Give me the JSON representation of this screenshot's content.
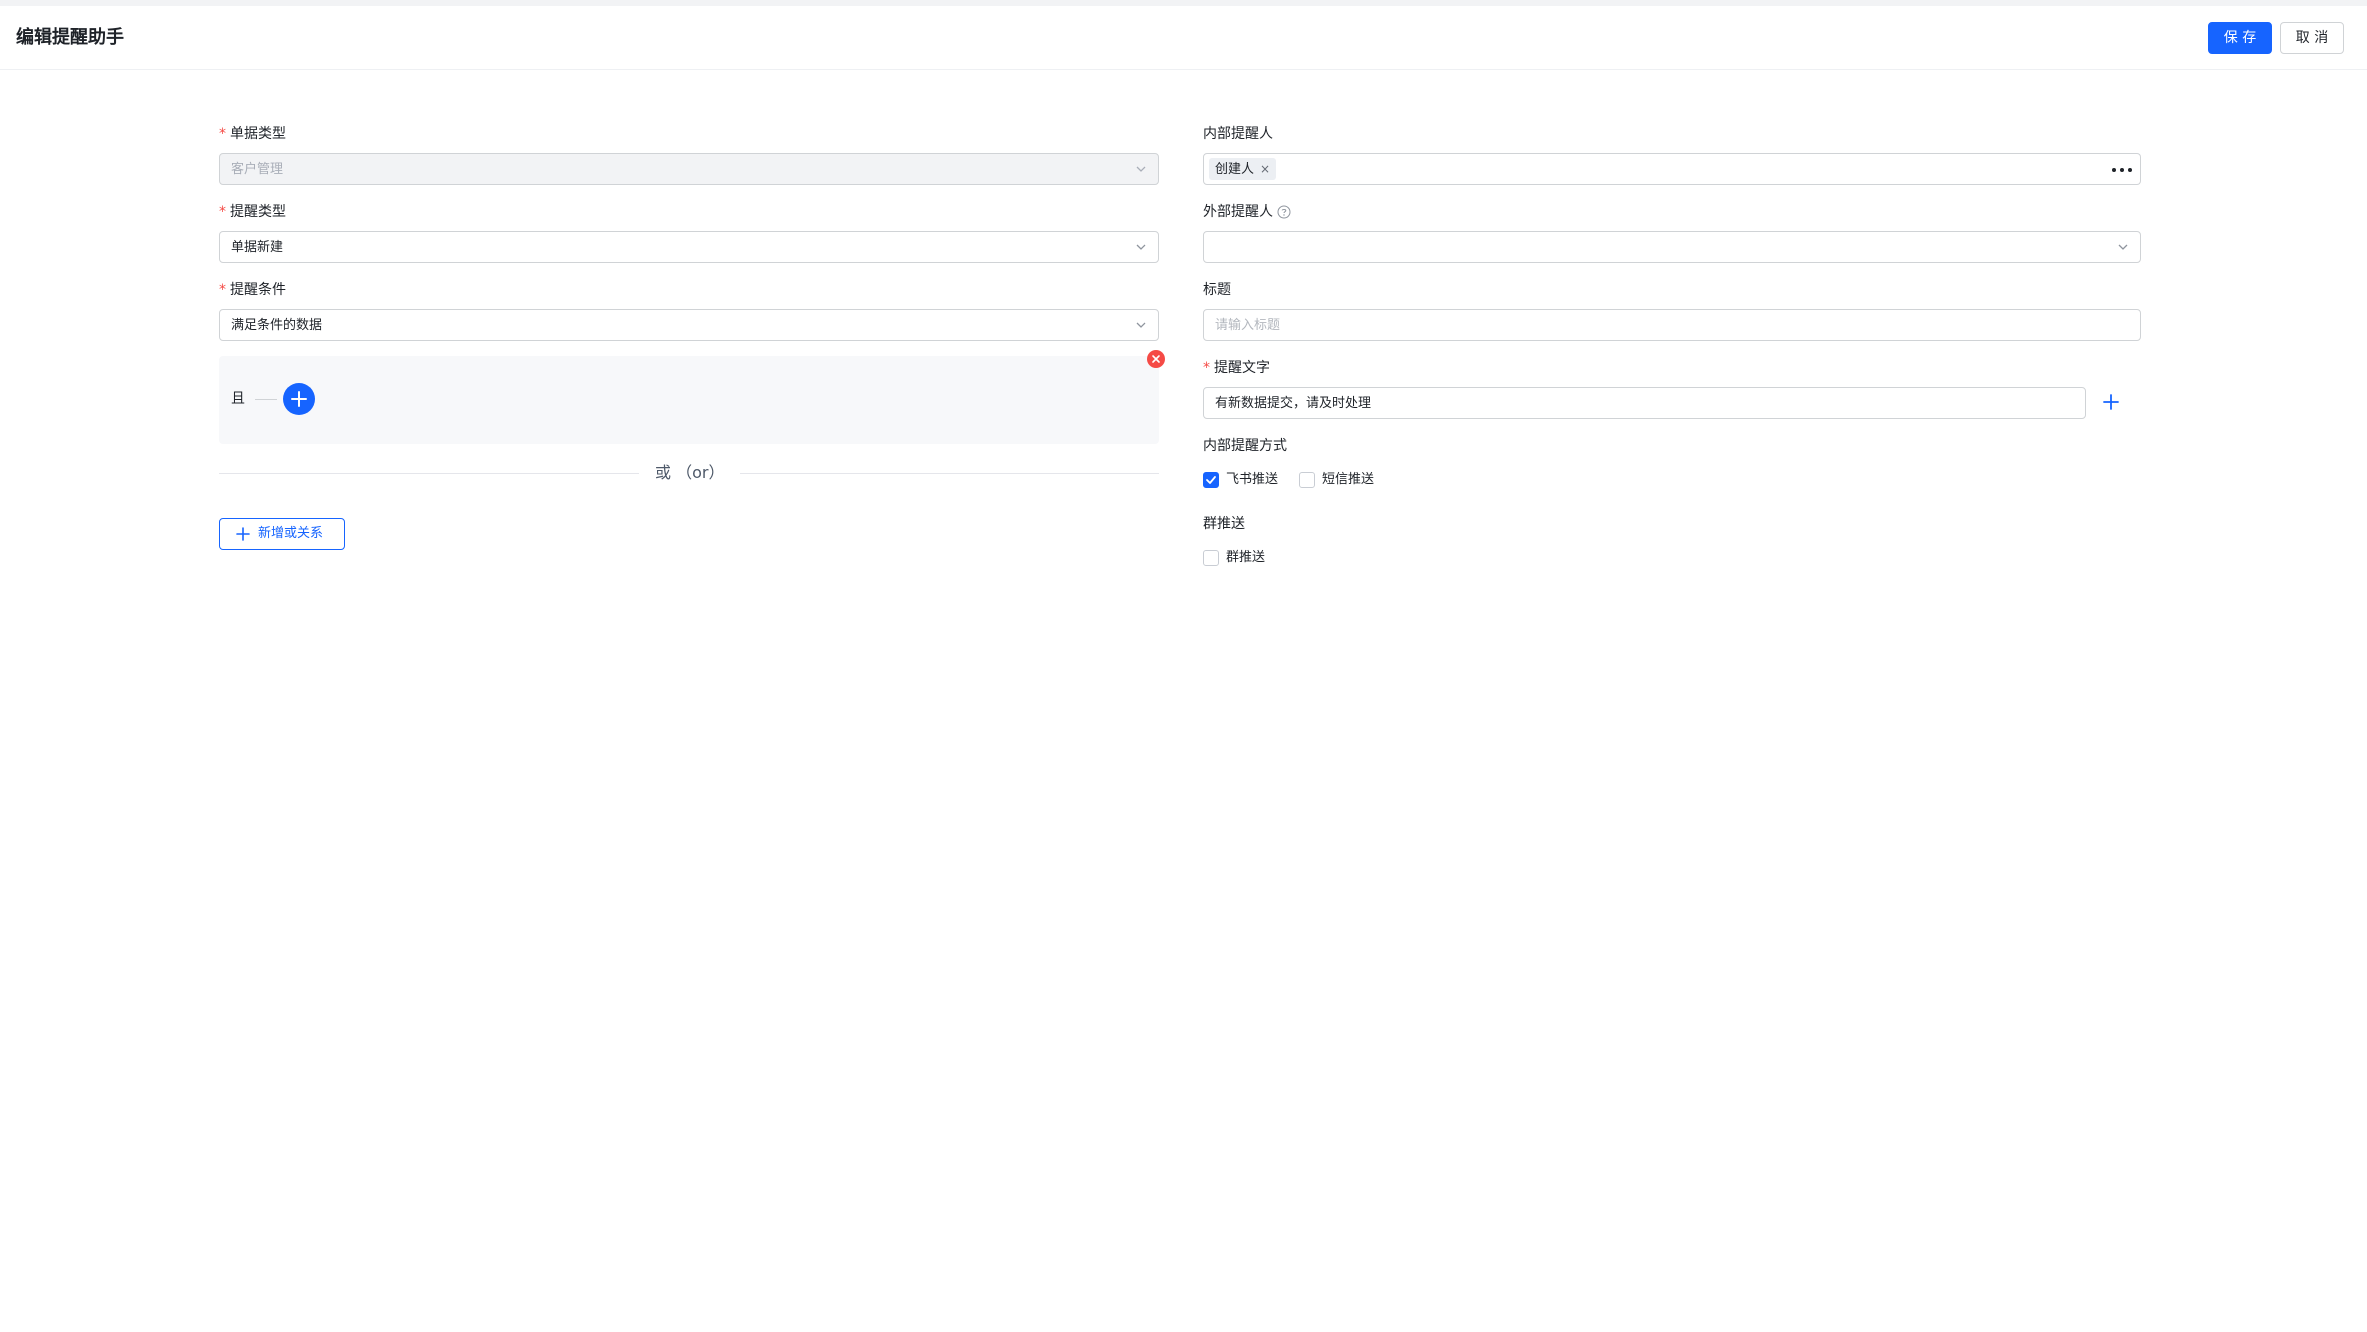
{
  "header": {
    "title": "编辑提醒助手",
    "save_label": "保 存",
    "cancel_label": "取 消"
  },
  "left": {
    "doc_type": {
      "label": "单据类型",
      "required": "*",
      "value": "客户管理"
    },
    "remind_type": {
      "label": "提醒类型",
      "required": "*",
      "value": "单据新建"
    },
    "remind_condition": {
      "label": "提醒条件",
      "required": "*",
      "value": "满足条件的数据"
    },
    "condition_group": {
      "and_label": "且"
    },
    "or_divider": "或 （or）",
    "add_or_label": "新增或关系"
  },
  "right": {
    "internal_reminder": {
      "label": "内部提醒人",
      "tag": "创建人",
      "tag_remove": "×"
    },
    "external_reminder": {
      "label": "外部提醒人",
      "value": ""
    },
    "title": {
      "label": "标题",
      "placeholder": "请输入标题"
    },
    "remind_text": {
      "label": "提醒文字",
      "required": "*",
      "value": "有新数据提交，请及时处理"
    },
    "internal_method": {
      "label": "内部提醒方式",
      "options": [
        {
          "label": "飞书推送",
          "checked": true
        },
        {
          "label": "短信推送",
          "checked": false
        }
      ]
    },
    "group_push": {
      "label": "群推送",
      "options": [
        {
          "label": "群推送",
          "checked": false
        }
      ]
    }
  },
  "colors": {
    "primary": "#1664ff",
    "danger": "#f54a45",
    "border": "#d0d3d6"
  }
}
